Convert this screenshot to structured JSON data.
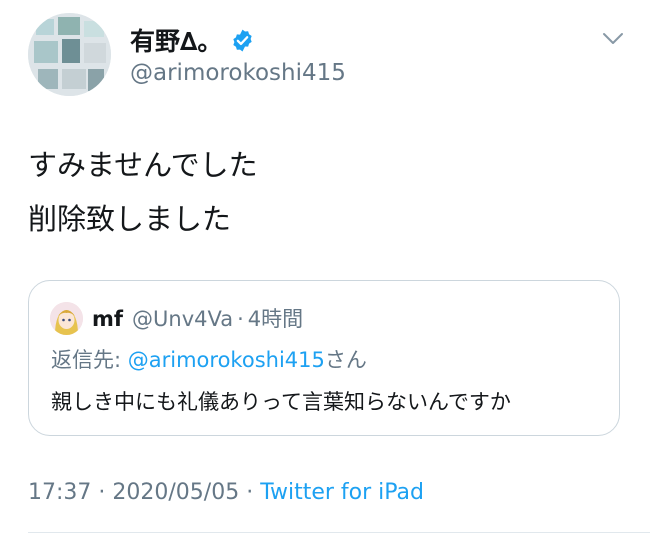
{
  "author": {
    "display_name": "有野∆。",
    "handle": "@arimorokoshi415"
  },
  "tweet": {
    "lines": [
      "すみませんでした",
      "削除致しました"
    ]
  },
  "quote": {
    "name": "mf",
    "handle": "@Unv4Va",
    "separator": "·",
    "time": "4時間",
    "reply_prefix": "返信先: ",
    "reply_handle": "@arimorokoshi415",
    "reply_suffix": "さん",
    "text": "親しき中にも礼儀ありって言葉知らないんですか"
  },
  "meta": {
    "time": "17:37",
    "sep1": " · ",
    "date": "2020/05/05",
    "sep2": " · ",
    "source": "Twitter for iPad"
  },
  "colors": {
    "link": "#1da1f2",
    "secondary_text": "#657786",
    "border": "#ccd6dd"
  },
  "icons": [
    "verified-badge-icon",
    "chevron-down-icon"
  ]
}
